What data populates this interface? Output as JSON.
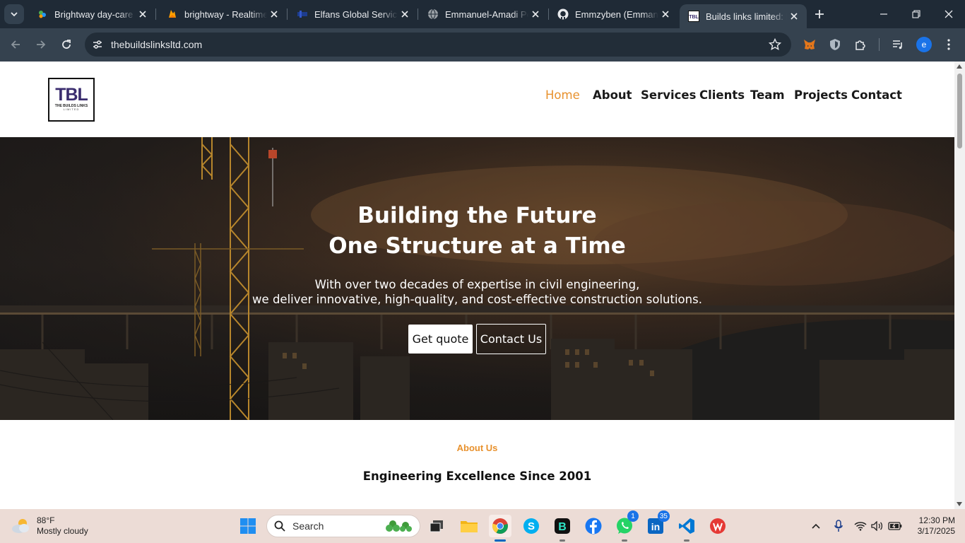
{
  "browser": {
    "tabs": [
      {
        "title": "Brightway day-care and",
        "active": false
      },
      {
        "title": "brightway - Realtime Dat",
        "active": false
      },
      {
        "title": "Elfans Global Services",
        "active": false
      },
      {
        "title": "Emmanuel-Amadi Portfolio",
        "active": false
      },
      {
        "title": "Emmzyben (Emmanuel",
        "active": false
      },
      {
        "title": "Builds links limited: Bu",
        "active": true
      }
    ],
    "url": "thebuildslinksltd.com",
    "profile_initial": "e"
  },
  "site": {
    "logo": {
      "mark": "TBL",
      "name": "THE BUILDS LINKS",
      "sub": "LIMITED"
    },
    "nav": [
      {
        "label": "Home",
        "active": true
      },
      {
        "label": "About",
        "active": false
      },
      {
        "label": "Services",
        "active": false
      },
      {
        "label": "Clients",
        "active": false
      },
      {
        "label": "Team",
        "active": false
      },
      {
        "label": "Projects",
        "active": false
      },
      {
        "label": "Contact",
        "active": false
      }
    ],
    "hero": {
      "title_line1": "Building the Future",
      "title_line2": "One Structure at a Time",
      "sub_line1": "With over two decades of expertise in civil engineering,",
      "sub_line2": "we deliver innovative, high-quality, and cost-effective construction solutions.",
      "primary_button": "Get quote",
      "secondary_button": "Contact Us"
    },
    "about": {
      "label": "About Us",
      "title": "Engineering Excellence Since 2001"
    },
    "accent_color": "#e8912d"
  },
  "taskbar": {
    "weather": {
      "temp": "88°F",
      "condition": "Mostly cloudy"
    },
    "search_placeholder": "Search",
    "whatsapp_badge": "1",
    "linkedin_badge": "35",
    "time": "12:30 PM",
    "date": "3/17/2025"
  }
}
